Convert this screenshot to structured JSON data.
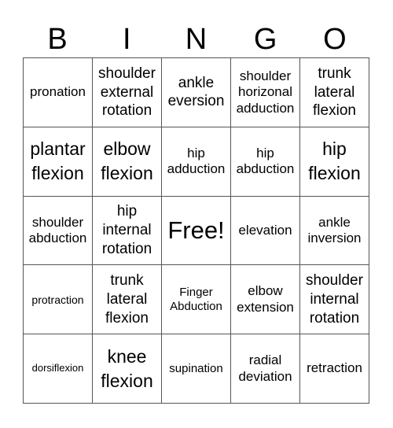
{
  "header": {
    "letters": [
      "B",
      "I",
      "N",
      "G",
      "O"
    ]
  },
  "grid": {
    "rows": [
      [
        "pronation",
        "shoulder external rotation",
        "ankle eversion",
        "shoulder horizonal adduction",
        "trunk lateral flexion"
      ],
      [
        "plantar flexion",
        "elbow flexion",
        "hip adduction",
        "hip abduction",
        "hip flexion"
      ],
      [
        "shoulder abduction",
        "hip internal rotation",
        "Free!",
        "elevation",
        "ankle inversion"
      ],
      [
        "protraction",
        "trunk lateral flexion",
        "Finger Abduction",
        "elbow extension",
        "shoulder internal rotation"
      ],
      [
        "dorsiflexion",
        "knee flexion",
        "supination",
        "radial deviation",
        "retraction"
      ]
    ]
  },
  "colors": {
    "grid_line": "#555555",
    "text": "#000000",
    "background": "#ffffff"
  }
}
